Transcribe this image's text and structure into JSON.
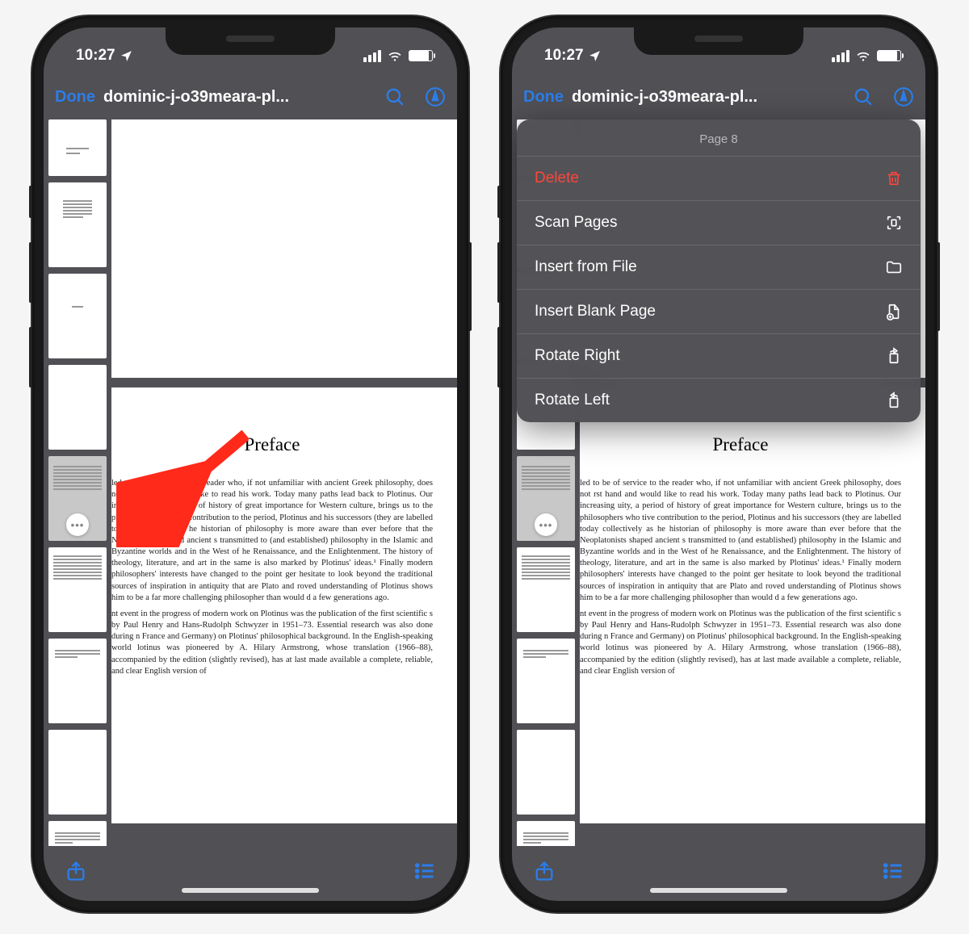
{
  "status": {
    "time": "10:27"
  },
  "nav": {
    "done": "Done",
    "title": "dominic-j-o39meara-pl..."
  },
  "preface": {
    "heading": "Preface",
    "para1": "led to be of service to the reader who, if not unfamiliar with ancient Greek philosophy, does not rst hand and would like to read his work. Today many paths lead back to Plotinus. Our increasing uity, a period of history of great importance for Western culture, brings us to the philosophers who tive contribution to the period, Plotinus and his successors (they are labelled today collectively as he historian of philosophy is more aware than ever before that the Neoplatonists shaped ancient s transmitted to (and established) philosophy in the Islamic and Byzantine worlds and in the West of he Renaissance, and the Enlightenment. The history of theology, literature, and art in the same is also marked by Plotinus' ideas.¹ Finally modern philosophers' interests have changed to the point ger hesitate to look beyond the traditional sources of inspiration in antiquity that are Plato and roved understanding of Plotinus shows him to be a far more challenging philosopher than would d a few generations ago.",
    "para2": "nt event in the progress of modern work on Plotinus was the publication of the first scientific s by Paul Henry and Hans-Rudolph Schwyzer in 1951–73. Essential research was also done during n France and Germany) on Plotinus' philosophical background. In the English-speaking world lotinus was pioneered by A. Hilary Armstrong, whose translation (1966–88), accompanied by the edition (slightly revised), has at last made available a complete, reliable, and clear English version of"
  },
  "menu": {
    "header": "Page 8",
    "delete": "Delete",
    "scan": "Scan Pages",
    "insert_file": "Insert from File",
    "insert_blank": "Insert Blank Page",
    "rotate_right": "Rotate Right",
    "rotate_left": "Rotate Left"
  }
}
